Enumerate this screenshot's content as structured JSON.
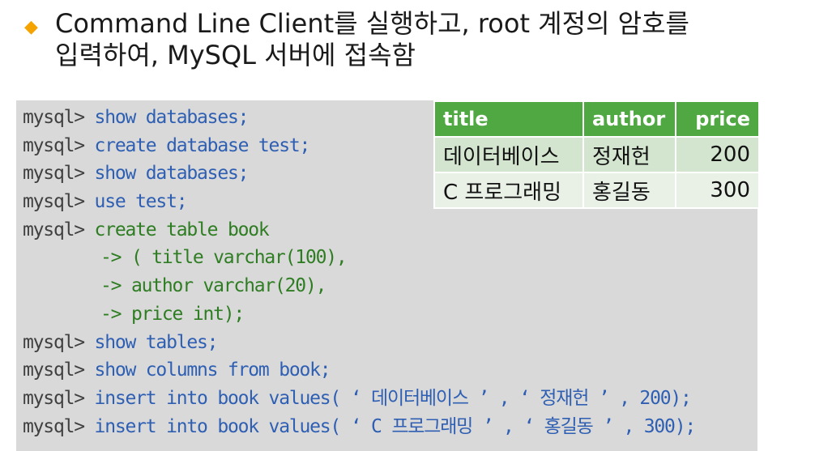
{
  "heading": {
    "line1": "Command Line Client를 실행하고, root 계정의 암호를",
    "line2": "입력하여, MySQL 서버에 접속함"
  },
  "code": {
    "prompt": "mysql>",
    "continuation": "->",
    "lines": [
      {
        "kind": "prompt",
        "text": "show databases;"
      },
      {
        "kind": "prompt",
        "text": "create database test;"
      },
      {
        "kind": "prompt",
        "text": "show databases;"
      },
      {
        "kind": "prompt",
        "text": "use test;"
      },
      {
        "kind": "prompt",
        "text": "create table book"
      },
      {
        "kind": "continuation",
        "text": "( title varchar(100),"
      },
      {
        "kind": "continuation",
        "text": "author varchar(20),"
      },
      {
        "kind": "continuation",
        "text": "price int);"
      },
      {
        "kind": "prompt",
        "text": "show tables;"
      },
      {
        "kind": "prompt",
        "text": "show columns from book;"
      },
      {
        "kind": "prompt",
        "text": "insert into book values( ‘ 데이터베이스 ’ , ‘ 정재헌 ’ , 200);"
      },
      {
        "kind": "prompt",
        "text": "insert into book values( ‘ C 프로그래밍 ’ , ‘ 홍길동 ’ , 300);"
      }
    ]
  },
  "result_table": {
    "headers": [
      "title",
      "author",
      "price"
    ],
    "rows": [
      [
        "데이터베이스",
        "정재헌",
        "200"
      ],
      [
        "C 프로그래밍",
        "홍길동",
        "300"
      ]
    ]
  },
  "colors": {
    "bullet": "#f5a300",
    "panel_bg": "#d9d9d9",
    "command_blue": "#2e5fb3",
    "continuation_green": "#2e7d22",
    "table_header": "#50a843",
    "table_row_1": "#d3e5cf",
    "table_row_2": "#e9f1e7"
  }
}
